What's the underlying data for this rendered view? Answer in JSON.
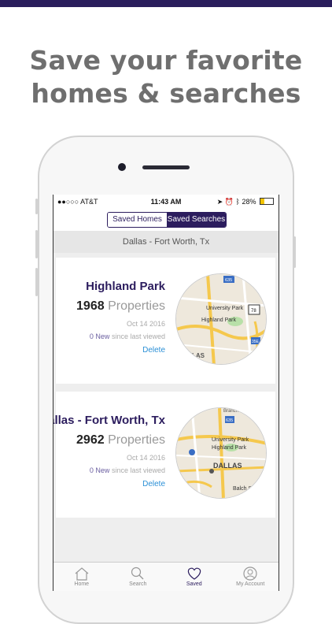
{
  "promo": {
    "line1": "Save your favorite",
    "line2": "homes & searches"
  },
  "status": {
    "carrier": "●●○○○ AT&T",
    "time": "11:43 AM",
    "battery": "28%"
  },
  "segment": {
    "left": "Saved Homes",
    "right": "Saved Searches",
    "selected": "Saved Searches"
  },
  "section_title": "Dallas - Fort Worth, Tx",
  "searches": [
    {
      "name": "Highland Park",
      "count": "1968",
      "count_label": "Properties",
      "date": "Oct 14 2016",
      "new_count": "0 New",
      "new_suffix": "since last viewed",
      "delete": "Delete",
      "map": {
        "labels": [
          "University Park",
          "Highland Park",
          "LAS"
        ],
        "shields": [
          "635",
          "78",
          "35E"
        ]
      }
    },
    {
      "name": "Dallas - Fort Worth, Tx",
      "count": "2962",
      "count_label": "Properties",
      "date": "Oct 14 2016",
      "new_count": "0 New",
      "new_suffix": "since last viewed",
      "delete": "Delete",
      "map": {
        "labels": [
          "Branch",
          "University Park",
          "Highland Park",
          "DALLAS",
          "Balch Sp"
        ],
        "shields": [
          "635"
        ]
      }
    }
  ],
  "tabs": [
    {
      "label": "Home",
      "icon": "house-icon"
    },
    {
      "label": "Search",
      "icon": "magnifier-icon"
    },
    {
      "label": "Saved",
      "icon": "heart-icon"
    },
    {
      "label": "My Account",
      "icon": "account-icon"
    }
  ],
  "colors": {
    "brand": "#2c1d5e",
    "link": "#2a8fd6",
    "promo_text": "#6f6f6f"
  }
}
